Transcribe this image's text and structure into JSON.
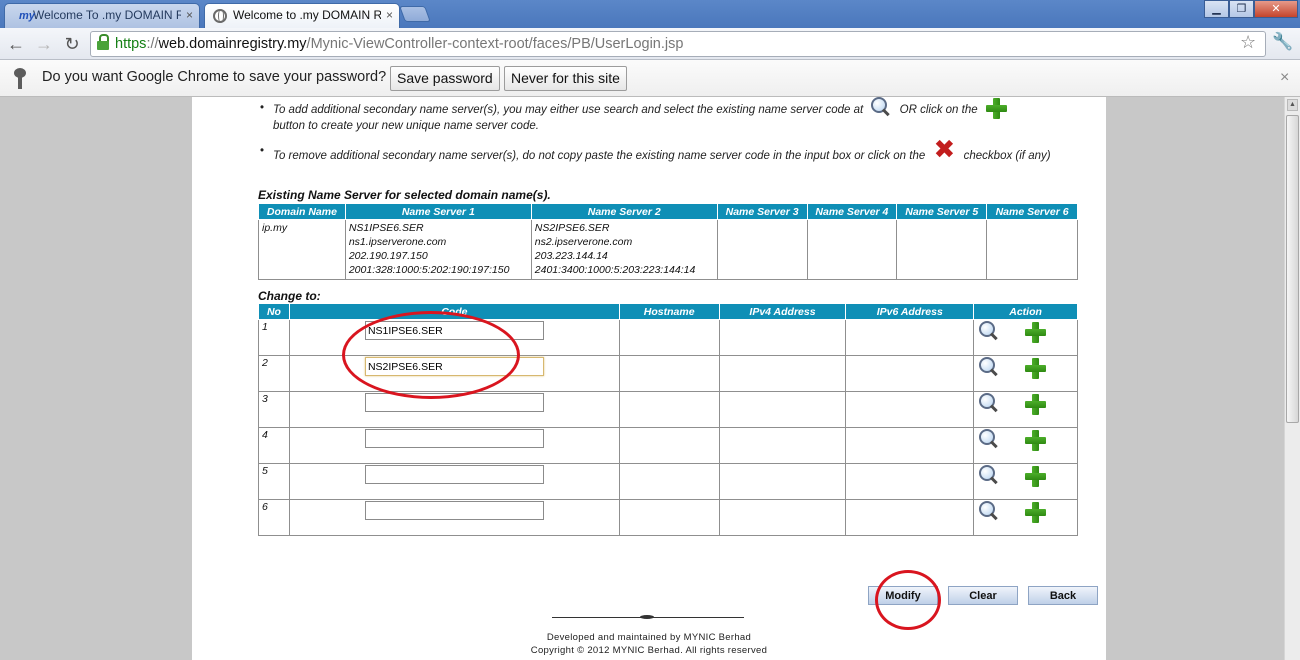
{
  "browser": {
    "tabs": [
      {
        "title": "Welcome To .my DOMAIN REG",
        "favicon": "my-favicon-icon",
        "active": false
      },
      {
        "title": "Welcome to .my DOMAIN REG",
        "favicon": "globe-icon",
        "active": true
      }
    ],
    "tab_close_glyph": "×",
    "url_scheme": "https",
    "url_sep": "://",
    "url_host": "web.domainregistry.my",
    "url_path": "/Mynic-ViewController-context-root/faces/PB/UserLogin.jsp",
    "infobar": {
      "message": "Do you want Google Chrome to save your password?",
      "save_label": "Save password",
      "never_label": "Never for this site"
    },
    "colors": {
      "tabstrip": "#4a77bc",
      "secure": "#158015"
    }
  },
  "page": {
    "bullet_add_part1": "To add additional secondary name server(s), you may either use search and select the existing name server code at",
    "bullet_add_part2": "OR click on the",
    "bullet_add_part3": "button to create your new unique name server code.",
    "bullet_remove_part1": "To remove additional secondary name server(s), do not copy paste the existing name server code in the input box or click on the",
    "bullet_remove_part2": "checkbox (if any)",
    "existing_title": "Existing Name Server for selected domain name(s).",
    "existing_headers": [
      "Domain Name",
      "Name Server 1",
      "Name Server 2",
      "Name Server 3",
      "Name Server 4",
      "Name Server 5",
      "Name Server 6"
    ],
    "existing_row": {
      "domain": "ip.my",
      "ns1": [
        "NS1IPSE6.SER",
        "ns1.ipserverone.com",
        "202.190.197.150",
        "2001:328:1000:5:202:190:197:150"
      ],
      "ns2": [
        "NS2IPSE6.SER",
        "ns2.ipserverone.com",
        "203.223.144.14",
        "2401:3400:1000:5:203:223:144:14"
      ]
    },
    "change_title": "Change to:",
    "change_headers": [
      "No",
      "Code",
      "Hostname",
      "IPv4 Address",
      "IPv6 Address",
      "Action"
    ],
    "change_rows": [
      {
        "no": "1",
        "code": "NS1IPSE6.SER"
      },
      {
        "no": "2",
        "code": "NS2IPSE6.SER"
      },
      {
        "no": "3",
        "code": ""
      },
      {
        "no": "4",
        "code": ""
      },
      {
        "no": "5",
        "code": ""
      },
      {
        "no": "6",
        "code": ""
      }
    ],
    "buttons": {
      "modify": "Modify",
      "clear": "Clear",
      "back": "Back"
    },
    "footer": {
      "line1": "Developed and maintained by MYNIC Berhad",
      "line2": "Copyright © 2012 MYNIC Berhad. All rights reserved"
    },
    "colors": {
      "table_header": "#0f8fb6",
      "annotation": "#d9151f",
      "add_icon": "#3b9a1c"
    }
  }
}
